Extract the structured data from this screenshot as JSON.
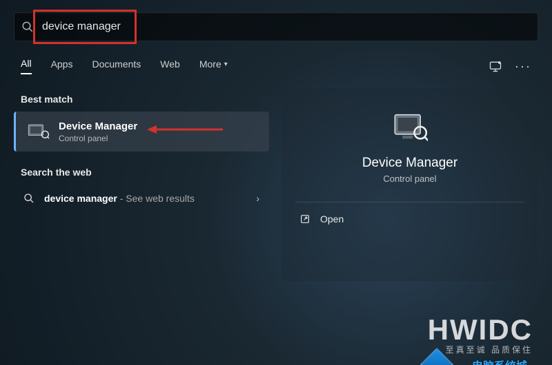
{
  "search": {
    "value": "device manager"
  },
  "tabs": {
    "items": [
      "All",
      "Apps",
      "Documents",
      "Web"
    ],
    "more_label": "More",
    "active_index": 0
  },
  "left": {
    "best_match_heading": "Best match",
    "best_match": {
      "title": "Device Manager",
      "subtitle": "Control panel"
    },
    "web_heading": "Search the web",
    "web_result": {
      "query": "device manager",
      "hint": " - See web results"
    }
  },
  "preview": {
    "title": "Device Manager",
    "subtitle": "Control panel",
    "actions": {
      "open": "Open"
    }
  },
  "watermark": {
    "main": "HWIDC",
    "sub": "至真至诚 品质保住",
    "secondary": "电脑系统城"
  }
}
